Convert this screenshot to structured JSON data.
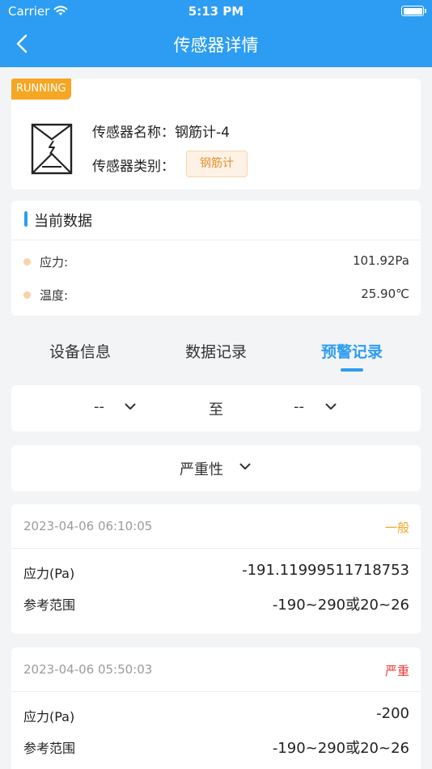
{
  "status": {
    "carrier": "Carrier",
    "time": "5:13 PM"
  },
  "header": {
    "title": "传感器详情"
  },
  "sensor": {
    "state": "RUNNING",
    "name_label": "传感器名称：",
    "name": "钢筋计-4",
    "type_label": "传感器类别：",
    "type": "钢筋计"
  },
  "current": {
    "title": "当前数据",
    "items": [
      {
        "label": "应力:",
        "value": "101.92Pa"
      },
      {
        "label": "温度:",
        "value": "25.90℃"
      }
    ]
  },
  "tabs": [
    {
      "label": "设备信息"
    },
    {
      "label": "数据记录"
    },
    {
      "label": "预警记录"
    }
  ],
  "active_tab": "预警记录",
  "filter": {
    "start": "--",
    "to": "至",
    "end": "--"
  },
  "severity": {
    "label": "严重性"
  },
  "records": [
    {
      "datetime": "2023-04-06 06:10:05",
      "level": "一般",
      "level_color": "#f5a623",
      "value_label": "应力(Pa)",
      "value": "-191.11999511718753",
      "range_label": "参考范围",
      "range": "-190~290或20~26"
    },
    {
      "datetime": "2023-04-06 05:50:03",
      "level": "严重",
      "level_color": "#e83b34",
      "value_label": "应力(Pa)",
      "value": "-200",
      "range_label": "参考范围",
      "range": "-190~290或20~26"
    }
  ],
  "colors": {
    "primary": "#2c9df2",
    "warning": "#f5a623",
    "danger": "#e83b34"
  }
}
